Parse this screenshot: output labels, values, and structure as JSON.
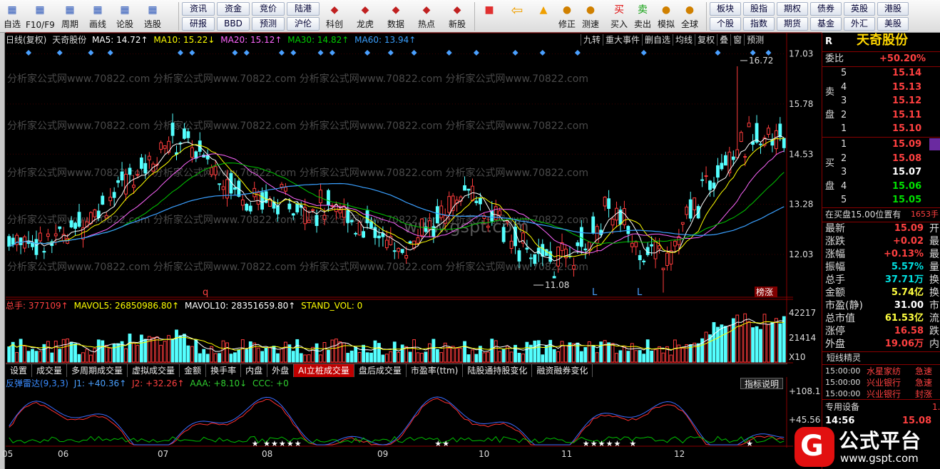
{
  "toolbar": {
    "icons": [
      {
        "label": "自选",
        "icon": "grid-icon"
      },
      {
        "label": "F10/F9",
        "icon": "document-icon"
      },
      {
        "label": "周期",
        "icon": "clock-icon"
      },
      {
        "label": "画线",
        "icon": "pencil-icon"
      },
      {
        "label": "论股",
        "icon": "chat-icon"
      },
      {
        "label": "选股",
        "icon": "target-icon"
      }
    ],
    "grid_buttons": [
      [
        "资讯",
        "资金",
        "竞价",
        "陆港"
      ],
      [
        "研报",
        "BBD",
        "预测",
        "沪伦"
      ]
    ],
    "icons2": [
      {
        "label": "科创",
        "icon": "chart-icon"
      },
      {
        "label": "龙虎",
        "icon": "dragon-icon"
      },
      {
        "label": "数据",
        "icon": "pe-icon"
      },
      {
        "label": "热点",
        "icon": "hot-icon"
      },
      {
        "label": "新股",
        "icon": "ipo-icon"
      }
    ],
    "icons3": [
      {
        "label": "修正",
        "icon": "coin-icon"
      },
      {
        "label": "测速",
        "icon": "speed-icon"
      },
      {
        "label": "买入",
        "icon": "buy-icon",
        "glyph": "买"
      },
      {
        "label": "卖出",
        "icon": "sell-icon",
        "glyph": "卖"
      },
      {
        "label": "模拟",
        "icon": "hammer-icon"
      },
      {
        "label": "全球",
        "icon": "globe-icon"
      }
    ],
    "grid2": [
      [
        "板块",
        "股指",
        "期权",
        "债券",
        "英股",
        "港股"
      ],
      [
        "个股",
        "指数",
        "期货",
        "基金",
        "外汇",
        "美股"
      ]
    ]
  },
  "chart_header": {
    "period": "日线(复权)",
    "name": "天奇股份",
    "ma5": "MA5: 14.72",
    "ma10": "MA10: 15.22",
    "ma20": "MA20: 15.12",
    "ma30": "MA30: 14.82",
    "ma60": "MA60: 13.94",
    "arrows": {
      "ma5": "↑",
      "ma10": "↓",
      "ma20": "↑",
      "ma30": "↑",
      "ma60": "↑"
    }
  },
  "chart_buttons": [
    "九转",
    "重大事件",
    "删自选",
    "均线",
    "复权",
    "叠",
    "窗",
    "预测"
  ],
  "price_axis": [
    "17.03",
    "15.78",
    "14.53",
    "13.28",
    "12.03"
  ],
  "annotations": {
    "high": "16.72",
    "low": "11.08",
    "q": "q",
    "L1": "L",
    "L2": "L",
    "bang": "榜涨"
  },
  "watermark": "分析家公式网www.70822.com",
  "watermark2": "www.gspt.com",
  "volume_header": {
    "zongshou": "总手: 377109",
    "mavol5": "MAVOL5: 26850986.80",
    "mavol10": "MAVOL10: 28351659.80",
    "standvol": "STAND_VOL: 0",
    "arrow1": "↑",
    "arrow2": "↑",
    "arrow3": "↑"
  },
  "volume_axis": [
    "42217",
    "21414",
    "X10"
  ],
  "tabs": [
    "设置",
    "成交量",
    "多周期成交量",
    "虚拟成交量",
    "金额",
    "换手率",
    "内盘",
    "外盘",
    "AI立桩成交量",
    "盘后成交量",
    "市盈率(ttm)",
    "陆股通持股变化",
    "融资融券变化"
  ],
  "active_tab": "AI立桩成交量",
  "indicator_header": {
    "name": "反弹雷达(9,3,3)",
    "j1": "J1: +40.36",
    "j2": "J2: +32.26",
    "aaa": "AAA: +8.10",
    "ccc": "CCC: +0",
    "a1": "↑",
    "a2": "↑",
    "a3": "↓"
  },
  "indicator_button": "指标说明",
  "indicator_axis": [
    "+108.1",
    "+45.56"
  ],
  "x_axis": [
    "05",
    "06",
    "07",
    "08",
    "09",
    "10",
    "11",
    "12"
  ],
  "right_panel": {
    "code_label": "R",
    "stock_name": "天奇股份",
    "weibi_label": "委比",
    "weibi": "+50.20%",
    "sell_label": "卖",
    "buy_label": "买",
    "pan_label": "盘",
    "asks": [
      {
        "lvl": "5",
        "price": "15.14"
      },
      {
        "lvl": "4",
        "price": "15.13"
      },
      {
        "lvl": "3",
        "price": "15.12"
      },
      {
        "lvl": "2",
        "price": "15.11"
      },
      {
        "lvl": "1",
        "price": "15.10"
      }
    ],
    "bids": [
      {
        "lvl": "1",
        "price": "15.09"
      },
      {
        "lvl": "2",
        "price": "15.08"
      },
      {
        "lvl": "3",
        "price": "15.07"
      },
      {
        "lvl": "4",
        "price": "15.06"
      },
      {
        "lvl": "5",
        "price": "15.05"
      }
    ],
    "queue": "在买盘15.00位置有",
    "queue_val": "1653手",
    "stats": [
      {
        "k": "最新",
        "v": "15.09",
        "r": "开"
      },
      {
        "k": "涨跌",
        "v": "+0.02",
        "r": "最"
      },
      {
        "k": "涨幅",
        "v": "+0.13%",
        "r": "最"
      },
      {
        "k": "振幅",
        "v": "5.57%",
        "r": "量"
      },
      {
        "k": "总手",
        "v": "37.71万",
        "r": "换"
      },
      {
        "k": "金额",
        "v": "5.74亿",
        "r": "换"
      },
      {
        "k": "市盈(静)",
        "v": "31.00",
        "r": "市"
      },
      {
        "k": "总市值",
        "v": "61.53亿",
        "r": "流"
      },
      {
        "k": "涨停",
        "v": "16.58",
        "r": "跌"
      },
      {
        "k": "外盘",
        "v": "19.06万",
        "r": "内"
      }
    ],
    "spirit_title": "短线精灵",
    "spirit": [
      {
        "t": "15:00:00",
        "n": "水星家纺",
        "e": "急速"
      },
      {
        "t": "15:00:00",
        "n": "兴业银行",
        "e": "急速"
      },
      {
        "t": "15:00:00",
        "n": "兴业银行",
        "e": "封涨"
      }
    ],
    "device": "专用设备",
    "device_v": "1.",
    "last_time": "14:56",
    "last_price": "15.08"
  },
  "logo": {
    "t1": "公式平台",
    "t2": "www.gspt.com"
  },
  "colors": {
    "up": "#ff3c3c",
    "down": "#54ffff",
    "ma5": "#ffffff",
    "ma10": "#ffff00",
    "ma20": "#ff66ff",
    "ma30": "#00c800",
    "ma60": "#3aa0ff"
  }
}
